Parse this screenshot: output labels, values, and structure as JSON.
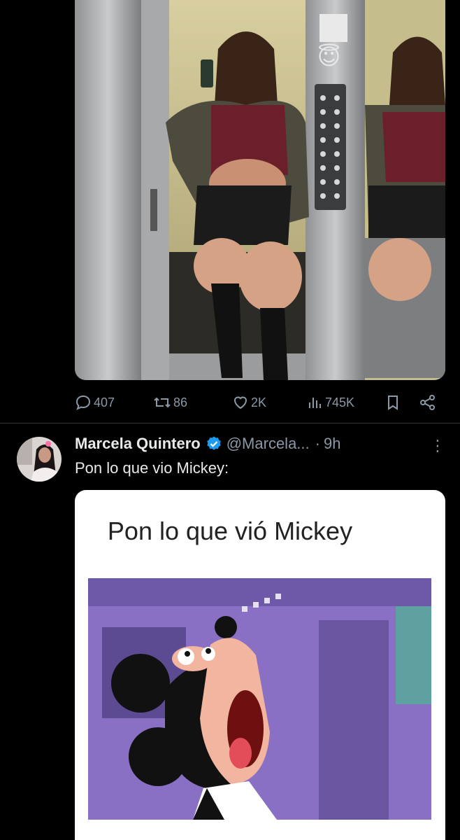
{
  "tweet1": {
    "stats": {
      "replies": "407",
      "reposts": "86",
      "likes": "2K",
      "views": "745K"
    },
    "overlay_emoji": "😇"
  },
  "tweet2": {
    "author_name": "Marcela Quintero",
    "handle": "@Marcela...",
    "separator": "·",
    "time": "9h",
    "more": "⋮",
    "text": "Pon lo que vio Mickey:",
    "card_caption": "Pon lo que vió Mickey"
  },
  "colors": {
    "background": "#000000",
    "text": "#e7e9ea",
    "muted": "#8b98a5",
    "verified": "#1d9bf0"
  }
}
